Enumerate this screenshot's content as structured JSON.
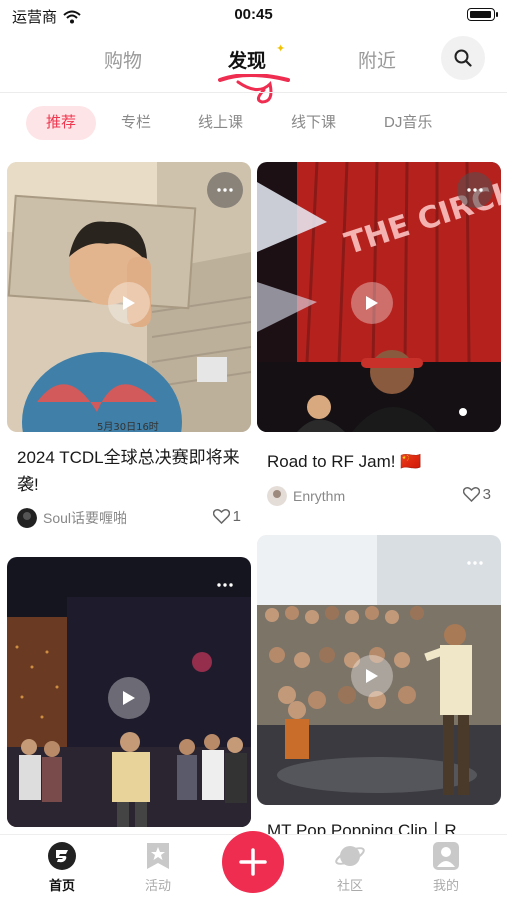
{
  "status_bar": {
    "carrier": "运营商",
    "time": "00:45"
  },
  "top_nav": {
    "tabs": [
      "购物",
      "发现",
      "附近"
    ],
    "active_tab": "发现"
  },
  "sub_tabs": [
    "推荐",
    "专栏",
    "线上课",
    "线下课",
    "DJ音乐"
  ],
  "feed": [
    {
      "title": "2024 TCDL全球总决赛即将来袭!",
      "author": "Soul话要喱啪",
      "likes": "1",
      "overlay_text": "5月30日16时"
    },
    {
      "title": "Road to RF Jam! 🇨🇳",
      "author": "Enrythm",
      "likes": "3",
      "overlay_text": "THE CIRCLE"
    },
    {
      "title": "",
      "author": "",
      "likes": ""
    },
    {
      "title": "MT Pop Popping Clip丨R",
      "author": "",
      "likes": ""
    }
  ],
  "tab_bar": {
    "items": [
      {
        "label": "首页",
        "icon": "home-logo-icon",
        "active": true
      },
      {
        "label": "活动",
        "icon": "star-bookmark-icon",
        "active": false
      },
      {
        "label": "社区",
        "icon": "planet-icon",
        "active": false
      },
      {
        "label": "我的",
        "icon": "person-icon",
        "active": false
      }
    ],
    "center_action": "plus-icon"
  },
  "colors": {
    "accent": "#ef2d50",
    "chip_active_bg": "#fde4e6",
    "chip_active_text": "#f0364e"
  }
}
